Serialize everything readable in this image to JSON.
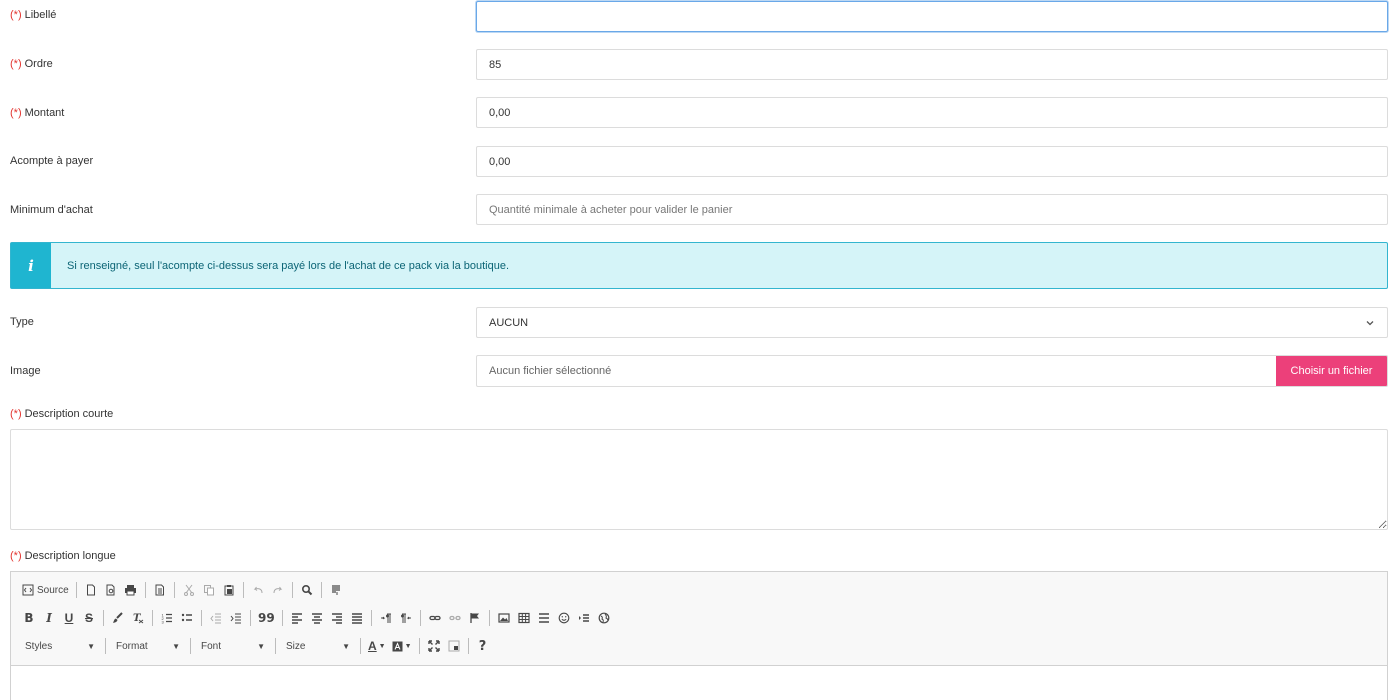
{
  "required_marker": "(*)",
  "fields": {
    "libelle": {
      "label": "Libellé",
      "value": ""
    },
    "ordre": {
      "label": "Ordre",
      "value": "85"
    },
    "montant": {
      "label": "Montant",
      "value": "0,00"
    },
    "acompte": {
      "label": "Acompte à payer",
      "value": "0,00"
    },
    "minimum": {
      "label": "Minimum d'achat",
      "value": "",
      "placeholder": "Quantité minimale à acheter pour valider le panier"
    }
  },
  "info": {
    "icon": "info-icon",
    "symbol": "i",
    "text": "Si renseigné, seul l'acompte ci-dessus sera payé lors de l'achat de ce pack via la boutique."
  },
  "type_select": {
    "label": "Type",
    "value": "AUCUN"
  },
  "image_field": {
    "label": "Image",
    "file_text": "Aucun fichier sélectionné",
    "button": "Choisir un fichier"
  },
  "desc_courte": {
    "label": "Description courte"
  },
  "desc_longue": {
    "label": "Description longue",
    "toolbar": {
      "source": "Source",
      "styles": "Styles",
      "format": "Format",
      "font": "Font",
      "size": "Size",
      "bold": "B",
      "italic": "I",
      "underline": "U",
      "strike": "S",
      "blockquote": "99",
      "help": "?",
      "text_color": "A"
    }
  },
  "colors": {
    "accent_button": "#ec407a",
    "info_icon_bg": "#1fb5d0",
    "info_bg": "#d5f4f8",
    "required": "#e3342f"
  }
}
